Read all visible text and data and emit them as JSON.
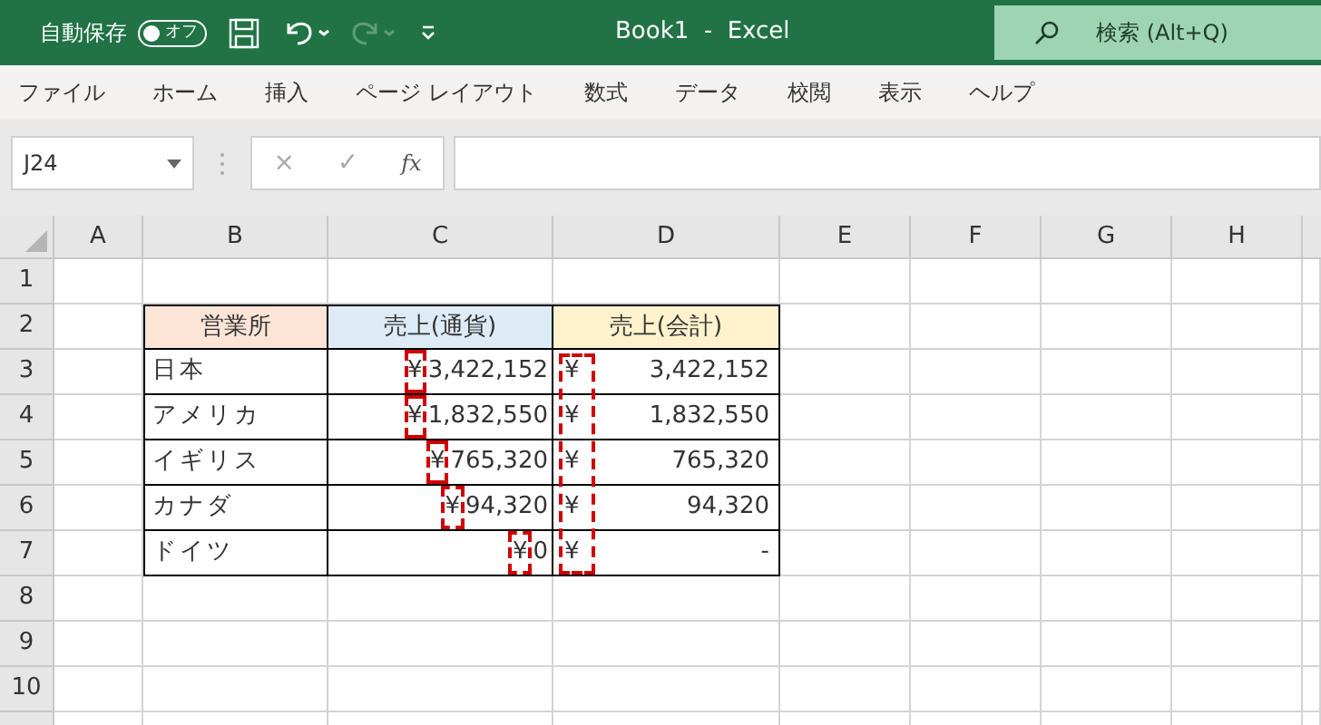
{
  "title_bar": {
    "autosave_label": "自動保存",
    "autosave_toggle": {
      "label": "オフ",
      "on": false
    },
    "redo_disabled": true,
    "title": "Book1  -  Excel",
    "search": {
      "placeholder": "検索 (Alt+Q)"
    }
  },
  "ribbon_tabs": [
    {
      "label": "ファイル",
      "selected": false
    },
    {
      "label": "ホーム",
      "selected": false
    },
    {
      "label": "挿入",
      "selected": false
    },
    {
      "label": "ページ レイアウト",
      "selected": false
    },
    {
      "label": "数式",
      "selected": false
    },
    {
      "label": "データ",
      "selected": false
    },
    {
      "label": "校閲",
      "selected": false
    },
    {
      "label": "表示",
      "selected": false
    },
    {
      "label": "ヘルプ",
      "selected": false
    }
  ],
  "formula_bar": {
    "name_box": "J24",
    "cancel": "×",
    "enter": "✓",
    "fx": "fx"
  },
  "sheet": {
    "columns": [
      "A",
      "B",
      "C",
      "D",
      "E",
      "F",
      "G",
      "H"
    ],
    "rows": [
      "1",
      "2",
      "3",
      "4",
      "5",
      "6",
      "7",
      "8",
      "9",
      "10"
    ],
    "table": {
      "headers": [
        {
          "text": "営業所",
          "color": "#fce4d6"
        },
        {
          "text": "売上(通貨)",
          "color": "#ddebf7"
        },
        {
          "text": "売上(会計)",
          "color": "#fff2cc"
        }
      ],
      "highlight_currency": true,
      "rows": [
        {
          "name": "日本",
          "currency": {
            "symbol": "¥",
            "amount": "3,422,152"
          },
          "accounting": {
            "symbol": "¥",
            "amount": "3,422,152"
          }
        },
        {
          "name": "アメリカ",
          "currency": {
            "symbol": "¥",
            "amount": "1,832,550"
          },
          "accounting": {
            "symbol": "¥",
            "amount": "1,832,550"
          }
        },
        {
          "name": "イギリス",
          "currency": {
            "symbol": "¥",
            "amount": "765,320"
          },
          "accounting": {
            "symbol": "¥",
            "amount": "765,320"
          }
        },
        {
          "name": "カナダ",
          "currency": {
            "symbol": "¥",
            "amount": "94,320"
          },
          "accounting": {
            "symbol": "¥",
            "amount": "94,320"
          }
        },
        {
          "name": "ドイツ",
          "currency": {
            "symbol": "¥",
            "amount": "0"
          },
          "accounting": {
            "symbol": "¥",
            "amount": "-"
          }
        }
      ]
    }
  }
}
